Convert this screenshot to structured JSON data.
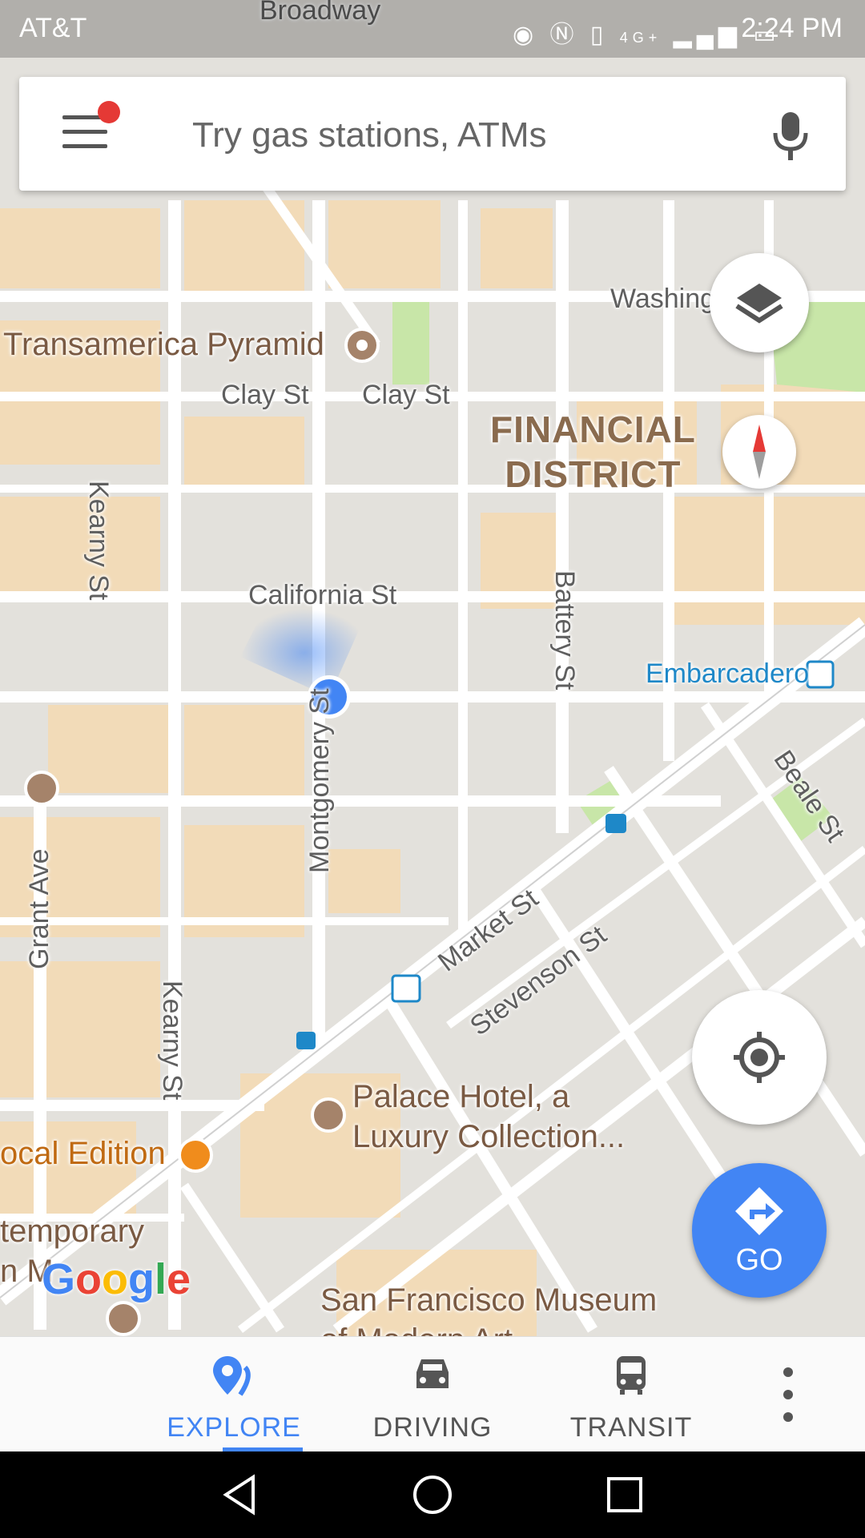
{
  "status_bar": {
    "carrier": "AT&T",
    "time": "2:24 PM",
    "network": "4G+"
  },
  "search": {
    "placeholder": "Try gas stations, ATMs",
    "has_notification": true
  },
  "map": {
    "streets": [
      "Broadway",
      "Clay St",
      "Clay St",
      "California St",
      "Kearny St",
      "Kearny St",
      "Montgomery St",
      "Battery St",
      "Market St",
      "Stevenson St",
      "Beale St",
      "Grant Ave",
      "Washing"
    ],
    "district": [
      "FINANCIAL",
      "DISTRICT"
    ],
    "pois": {
      "transamerica": "Transamerica Pyramid",
      "embarcadero": "Embarcadero",
      "palace_hotel_line1": "Palace Hotel, a",
      "palace_hotel_line2": "Luxury Collection...",
      "local_edition": "ocal Edition",
      "sfmoma_line1": "San Francisco Museum",
      "sfmoma_line2": "of Modern Art",
      "contemporary_line1": "temporary",
      "contemporary_line2": "n M"
    },
    "logo": [
      "G",
      "o",
      "o",
      "g",
      "l",
      "e"
    ],
    "logo_colors": [
      "#4285f4",
      "#ea4335",
      "#fbbc05",
      "#4285f4",
      "#34a853",
      "#ea4335"
    ]
  },
  "buttons": {
    "go_label": "GO"
  },
  "bottom_nav": {
    "items": [
      {
        "label": "EXPLORE",
        "icon": "explore-pin-icon",
        "active": true
      },
      {
        "label": "DRIVING",
        "icon": "car-icon",
        "active": false
      },
      {
        "label": "TRANSIT",
        "icon": "bus-icon",
        "active": false
      }
    ]
  },
  "colors": {
    "accent": "#4285f4",
    "map_background": "#e5e3df",
    "block_tan": "#f2dbb8",
    "park_green": "#c8e6a8"
  }
}
